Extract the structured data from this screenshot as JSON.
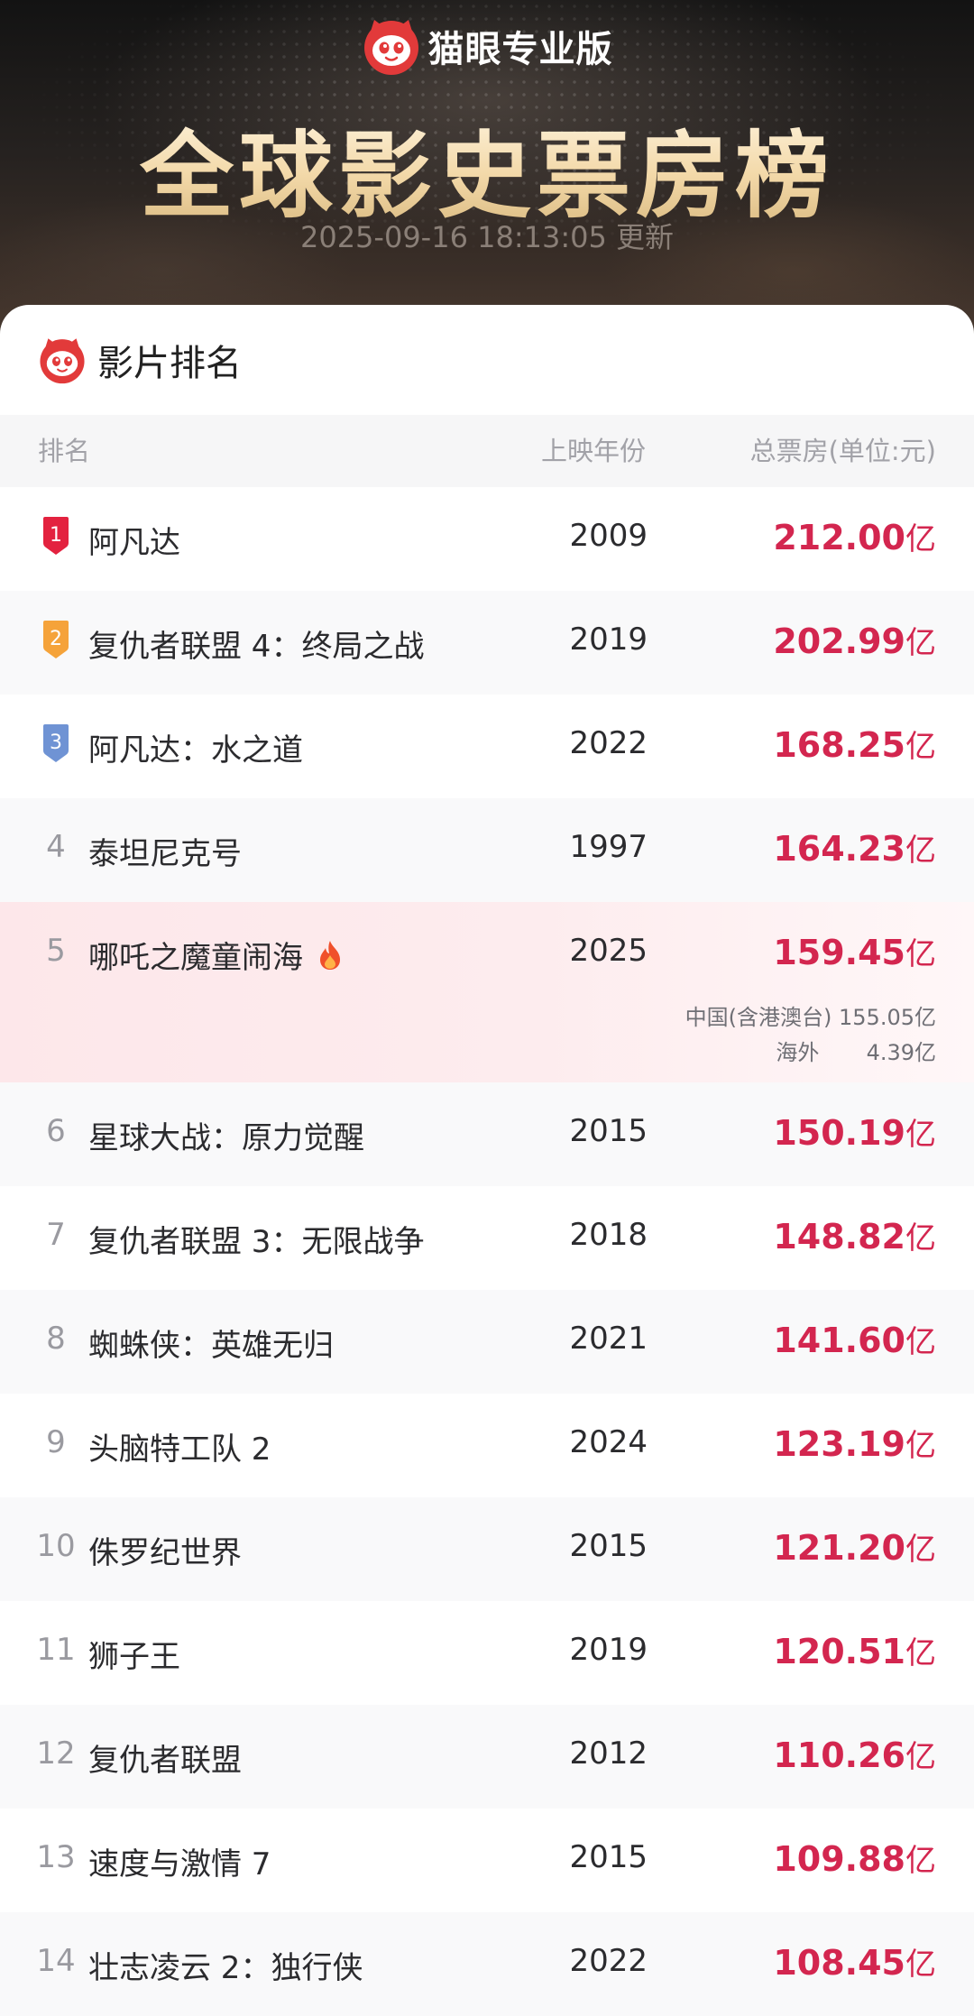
{
  "header": {
    "app_name": "猫眼专业版",
    "title": "全球影史票房榜",
    "updated_time": "2025-09-16 18:13:05",
    "updated_suffix": "更新"
  },
  "card": {
    "title": "影片排名"
  },
  "columns": {
    "rank": "排名",
    "year": "上映年份",
    "total": "总票房(单位:元)"
  },
  "unit": "亿",
  "colors": {
    "accent_red": "#d3264f",
    "medal_gold": "#e3223f",
    "medal_orange": "#f5a33a",
    "medal_blue": "#6f93d4"
  },
  "movies": [
    {
      "rank": "1",
      "title": "阿凡达",
      "year": "2009",
      "total": "212.00",
      "medal": "red"
    },
    {
      "rank": "2",
      "title": "复仇者联盟 4：终局之战",
      "year": "2019",
      "total": "202.99",
      "medal": "orange"
    },
    {
      "rank": "3",
      "title": "阿凡达：水之道",
      "year": "2022",
      "total": "168.25",
      "medal": "blue"
    },
    {
      "rank": "4",
      "title": "泰坦尼克号",
      "year": "1997",
      "total": "164.23"
    },
    {
      "rank": "5",
      "title": "哪吒之魔童闹海",
      "year": "2025",
      "total": "159.45",
      "icon": "fire-icon",
      "breakdown": [
        {
          "label": "中国(含港澳台)",
          "value": "155.05亿"
        },
        {
          "label": "海外",
          "value": "4.39亿"
        }
      ]
    },
    {
      "rank": "6",
      "title": "星球大战：原力觉醒",
      "year": "2015",
      "total": "150.19"
    },
    {
      "rank": "7",
      "title": "复仇者联盟 3：无限战争",
      "year": "2018",
      "total": "148.82"
    },
    {
      "rank": "8",
      "title": "蜘蛛侠：英雄无归",
      "year": "2021",
      "total": "141.60"
    },
    {
      "rank": "9",
      "title": "头脑特工队 2",
      "year": "2024",
      "total": "123.19"
    },
    {
      "rank": "10",
      "title": "侏罗纪世界",
      "year": "2015",
      "total": "121.20"
    },
    {
      "rank": "11",
      "title": "狮子王",
      "year": "2019",
      "total": "120.51"
    },
    {
      "rank": "12",
      "title": "复仇者联盟",
      "year": "2012",
      "total": "110.26"
    },
    {
      "rank": "13",
      "title": "速度与激情 7",
      "year": "2015",
      "total": "109.88"
    },
    {
      "rank": "14",
      "title": "壮志凌云 2：独行侠",
      "year": "2022",
      "total": "108.45"
    }
  ]
}
